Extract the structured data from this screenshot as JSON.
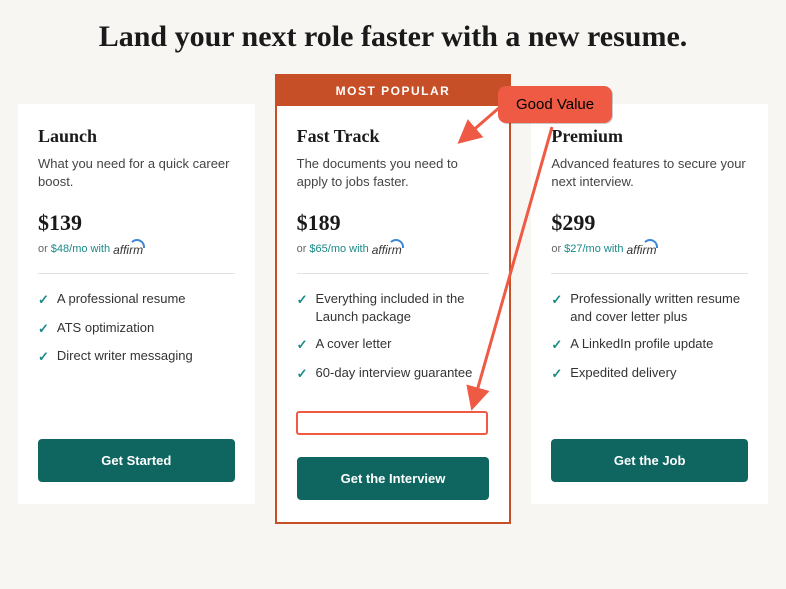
{
  "headline": "Land your next role faster with a new resume.",
  "popular_badge": "MOST POPULAR",
  "affirm_brand": "affirm",
  "annotation_label": "Good Value",
  "plans": [
    {
      "name": "Launch",
      "desc": "What you need for a quick career boost.",
      "price": "$139",
      "affirm_or": "or",
      "affirm_mo": "$48/mo with",
      "cta": "Get Started",
      "features": [
        "A professional resume",
        "ATS optimization",
        "Direct writer messaging"
      ]
    },
    {
      "name": "Fast Track",
      "desc": "The documents you need to apply to jobs faster.",
      "price": "$189",
      "affirm_or": "or",
      "affirm_mo": "$65/mo with",
      "cta": "Get the Interview",
      "features": [
        "Everything included in the Launch package",
        "A cover letter",
        "60-day interview guarantee"
      ]
    },
    {
      "name": "Premium",
      "desc": "Advanced features to secure your next interview.",
      "price": "$299",
      "affirm_or": "or",
      "affirm_mo": "$27/mo with",
      "cta": "Get the Job",
      "features": [
        "Professionally written resume and cover letter plus",
        "A LinkedIn profile update",
        "Expedited delivery"
      ]
    }
  ]
}
